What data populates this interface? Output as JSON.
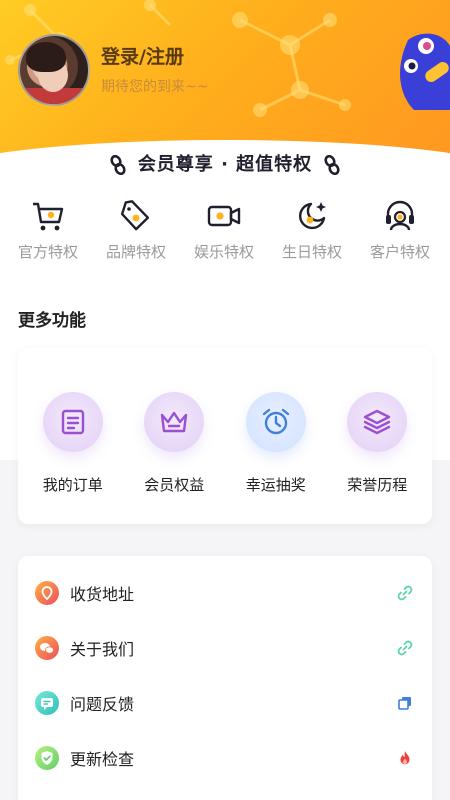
{
  "header": {
    "login_title": "登录/注册",
    "login_subtitle": "期待您的到来~~"
  },
  "vip": {
    "title": "会员尊享 · 超值特权"
  },
  "privileges": [
    {
      "label": "官方特权",
      "icon": "cart-icon"
    },
    {
      "label": "品牌特权",
      "icon": "tag-icon"
    },
    {
      "label": "娱乐特权",
      "icon": "video-icon"
    },
    {
      "label": "生日特权",
      "icon": "moon-icon"
    },
    {
      "label": "客户特权",
      "icon": "headset-icon"
    }
  ],
  "more": {
    "title": "更多功能",
    "features": [
      {
        "label": "我的订单",
        "icon": "order-icon"
      },
      {
        "label": "会员权益",
        "icon": "crown-icon"
      },
      {
        "label": "幸运抽奖",
        "icon": "alarm-icon"
      },
      {
        "label": "荣誉历程",
        "icon": "layers-icon"
      }
    ]
  },
  "list": [
    {
      "label": "收货地址",
      "icon": "address-icon",
      "right_icon": "link-icon"
    },
    {
      "label": "关于我们",
      "icon": "chat-icon",
      "right_icon": "link-icon"
    },
    {
      "label": "问题反馈",
      "icon": "feedback-icon",
      "right_icon": "copy-icon"
    },
    {
      "label": "更新检查",
      "icon": "shield-check-icon",
      "right_icon": "fire-icon"
    }
  ],
  "colors": {
    "header_start": "#ffcc24",
    "header_end": "#ff9622",
    "privilege_icon": "#1f1f2e",
    "feature_icon": "#9b4fd1",
    "alarm_icon": "#3f7fe0"
  }
}
